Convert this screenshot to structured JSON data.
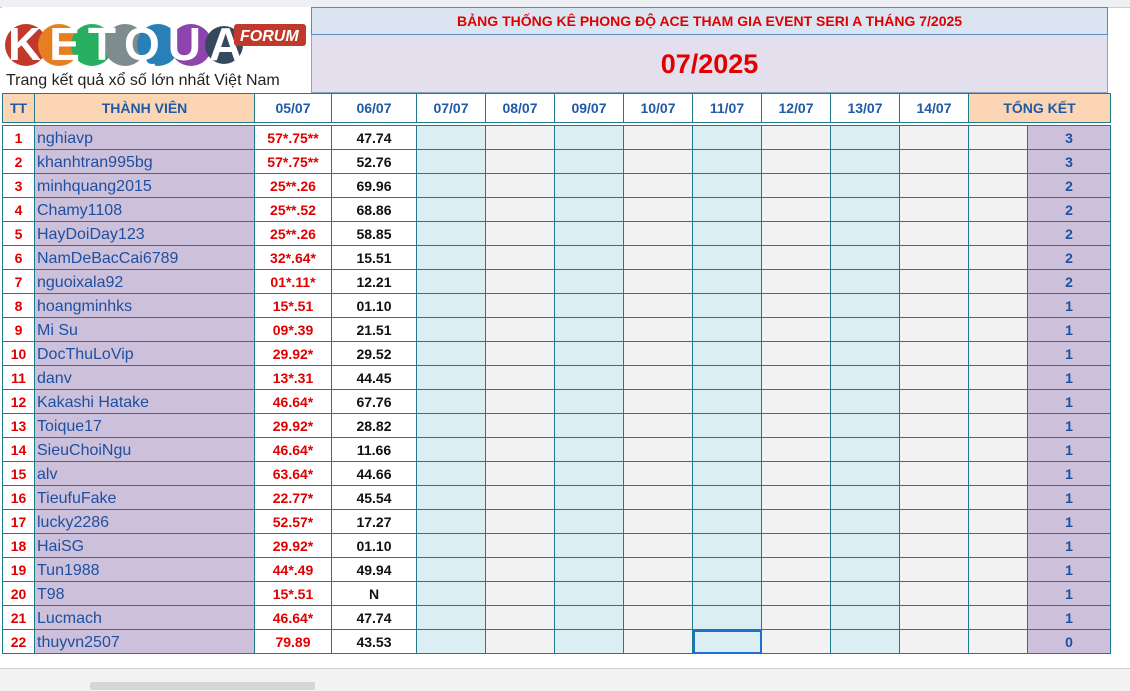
{
  "header": {
    "title": "BẢNG THỐNG KÊ PHONG ĐỘ ACE THAM GIA EVENT SERI A THÁNG 7/2025",
    "month": "07/2025"
  },
  "logo": {
    "brand": "KETQUA2",
    "badge": "FORUM",
    "tagline": "Trang kết quả xổ số lớn nhất Việt Nam"
  },
  "columns": {
    "tt": "TT",
    "member": "THÀNH VIÊN",
    "dates": [
      "05/07",
      "06/07",
      "07/07",
      "08/07",
      "09/07",
      "10/07",
      "11/07",
      "12/07",
      "13/07",
      "14/07"
    ],
    "total": "TỔNG KẾT"
  },
  "rows": [
    {
      "tt": "1",
      "name": "nghiavp",
      "d1": "57*.75**",
      "d2": "47.74",
      "total": "3"
    },
    {
      "tt": "2",
      "name": "khanhtran995bg",
      "d1": "57*.75**",
      "d2": "52.76",
      "total": "3"
    },
    {
      "tt": "3",
      "name": "minhquang2015",
      "d1": "25**.26",
      "d2": "69.96",
      "total": "2"
    },
    {
      "tt": "4",
      "name": "Chamy1108",
      "d1": "25**.52",
      "d2": "68.86",
      "total": "2"
    },
    {
      "tt": "5",
      "name": "HayDoiDay123",
      "d1": "25**.26",
      "d2": "58.85",
      "total": "2"
    },
    {
      "tt": "6",
      "name": "NamDeBacCai6789",
      "d1": "32*.64*",
      "d2": "15.51",
      "total": "2"
    },
    {
      "tt": "7",
      "name": "nguoixala92",
      "d1": "01*.11*",
      "d2": "12.21",
      "total": "2"
    },
    {
      "tt": "8",
      "name": "hoangminhks",
      "d1": "15*.51",
      "d2": "01.10",
      "total": "1"
    },
    {
      "tt": "9",
      "name": "Mi Su",
      "d1": "09*.39",
      "d2": "21.51",
      "total": "1"
    },
    {
      "tt": "10",
      "name": "DocThuLoVip",
      "d1": "29.92*",
      "d2": "29.52",
      "total": "1"
    },
    {
      "tt": "11",
      "name": "danv",
      "d1": "13*.31",
      "d2": "44.45",
      "total": "1"
    },
    {
      "tt": "12",
      "name": "Kakashi Hatake",
      "d1": "46.64*",
      "d2": "67.76",
      "total": "1"
    },
    {
      "tt": "13",
      "name": "Toique17",
      "d1": "29.92*",
      "d2": "28.82",
      "total": "1"
    },
    {
      "tt": "14",
      "name": "SieuChoiNgu",
      "d1": "46.64*",
      "d2": "11.66",
      "total": "1"
    },
    {
      "tt": "15",
      "name": "alv",
      "d1": "63.64*",
      "d2": "44.66",
      "total": "1"
    },
    {
      "tt": "16",
      "name": "TieufuFake",
      "d1": "22.77*",
      "d2": "45.54",
      "total": "1"
    },
    {
      "tt": "17",
      "name": "lucky2286",
      "d1": "52.57*",
      "d2": "17.27",
      "total": "1"
    },
    {
      "tt": "18",
      "name": "HaiSG",
      "d1": "29.92*",
      "d2": "01.10",
      "total": "1"
    },
    {
      "tt": "19",
      "name": "Tun1988",
      "d1": "44*.49",
      "d2": "49.94",
      "total": "1"
    },
    {
      "tt": "20",
      "name": "T98",
      "d1": "15*.51",
      "d2": "N",
      "total": "1"
    },
    {
      "tt": "21",
      "name": "Lucmach",
      "d1": "46.64*",
      "d2": "47.74",
      "total": "1"
    },
    {
      "tt": "22",
      "name": "thuyvn2507",
      "d1": "79.89",
      "d2": "43.53",
      "total": "0"
    }
  ]
}
